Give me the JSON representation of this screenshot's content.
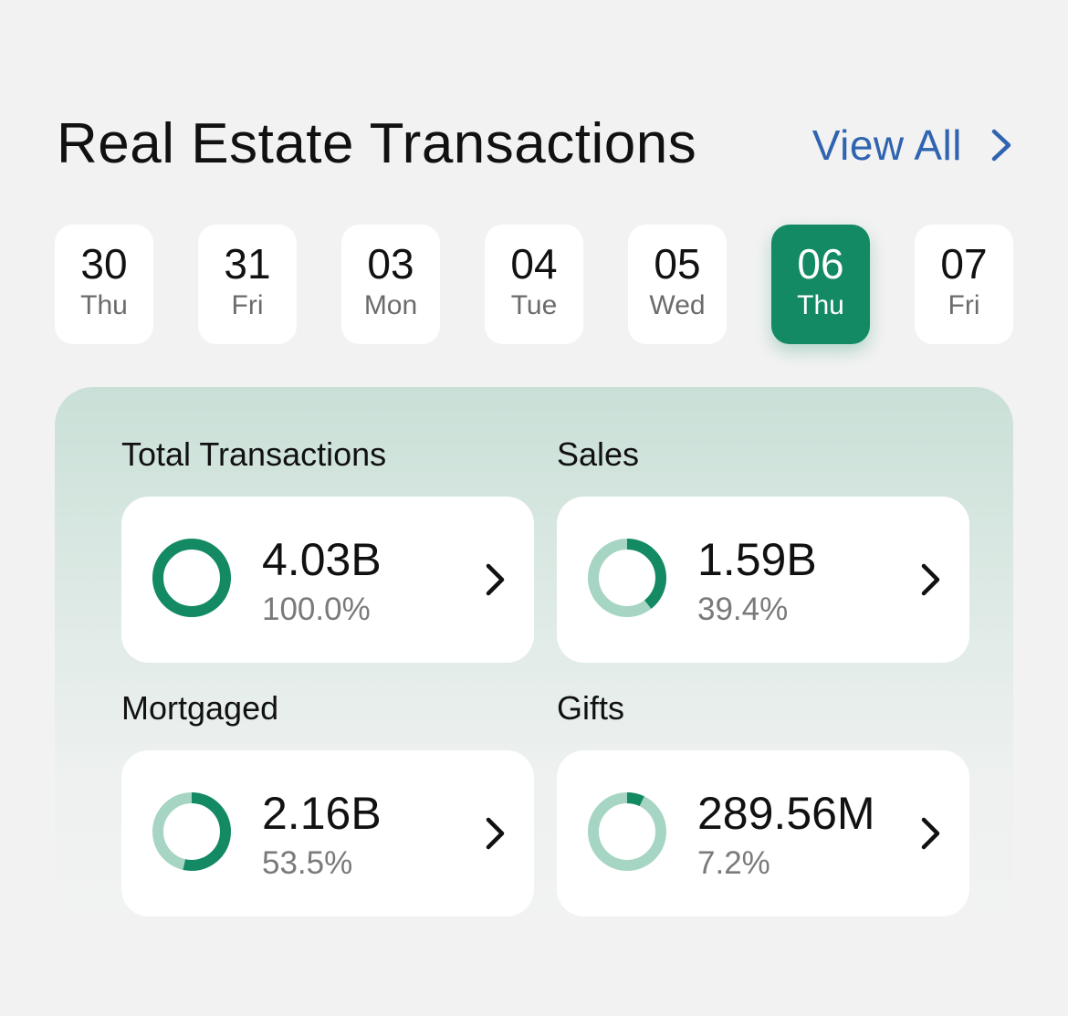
{
  "header": {
    "title": "Real Estate Transactions",
    "view_all_label": "View All"
  },
  "dates": [
    {
      "day": "30",
      "weekday": "Thu",
      "selected": false
    },
    {
      "day": "31",
      "weekday": "Fri",
      "selected": false
    },
    {
      "day": "03",
      "weekday": "Mon",
      "selected": false
    },
    {
      "day": "04",
      "weekday": "Tue",
      "selected": false
    },
    {
      "day": "05",
      "weekday": "Wed",
      "selected": false
    },
    {
      "day": "06",
      "weekday": "Thu",
      "selected": true
    },
    {
      "day": "07",
      "weekday": "Fri",
      "selected": false
    }
  ],
  "stats": [
    {
      "label": "Total Transactions",
      "value": "4.03B",
      "percent": "100.0%",
      "fraction": 1.0
    },
    {
      "label": "Sales",
      "value": "1.59B",
      "percent": "39.4%",
      "fraction": 0.394
    },
    {
      "label": "Mortgaged",
      "value": "2.16B",
      "percent": "53.5%",
      "fraction": 0.535
    },
    {
      "label": "Gifts",
      "value": "289.56M",
      "percent": "7.2%",
      "fraction": 0.072
    }
  ],
  "colors": {
    "accent": "#138a63",
    "donut_track": "#a6d5c3",
    "link": "#2f64b0",
    "background": "#f2f2f2"
  },
  "icons": {
    "view_all": "chevron-right-icon",
    "card_arrow": "chevron-right-icon"
  }
}
